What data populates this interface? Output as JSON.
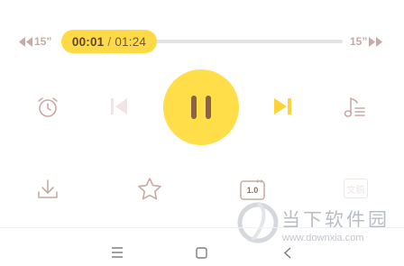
{
  "player": {
    "current_time": "00:01",
    "separator": "/",
    "duration": "01:24",
    "progress_fraction": 0.012,
    "rewind_label": "15”",
    "forward_label": "15”"
  },
  "controls": {
    "alarm": "alarm-clock-icon",
    "previous": "skip-previous-icon",
    "play_pause": "pause-icon",
    "next": "skip-next-icon",
    "playlist": "playlist-icon"
  },
  "actions": {
    "download": "download-icon",
    "favorite": "star-icon",
    "speed_label": "1.0",
    "subtitles_label": "文稿"
  },
  "watermark": {
    "brand": "当下软件园",
    "url": "www.downxia.com"
  },
  "colors": {
    "accent": "#ffda47",
    "icon_muted": "#c9aaa2",
    "icon_disabled": "#efe5e3"
  }
}
